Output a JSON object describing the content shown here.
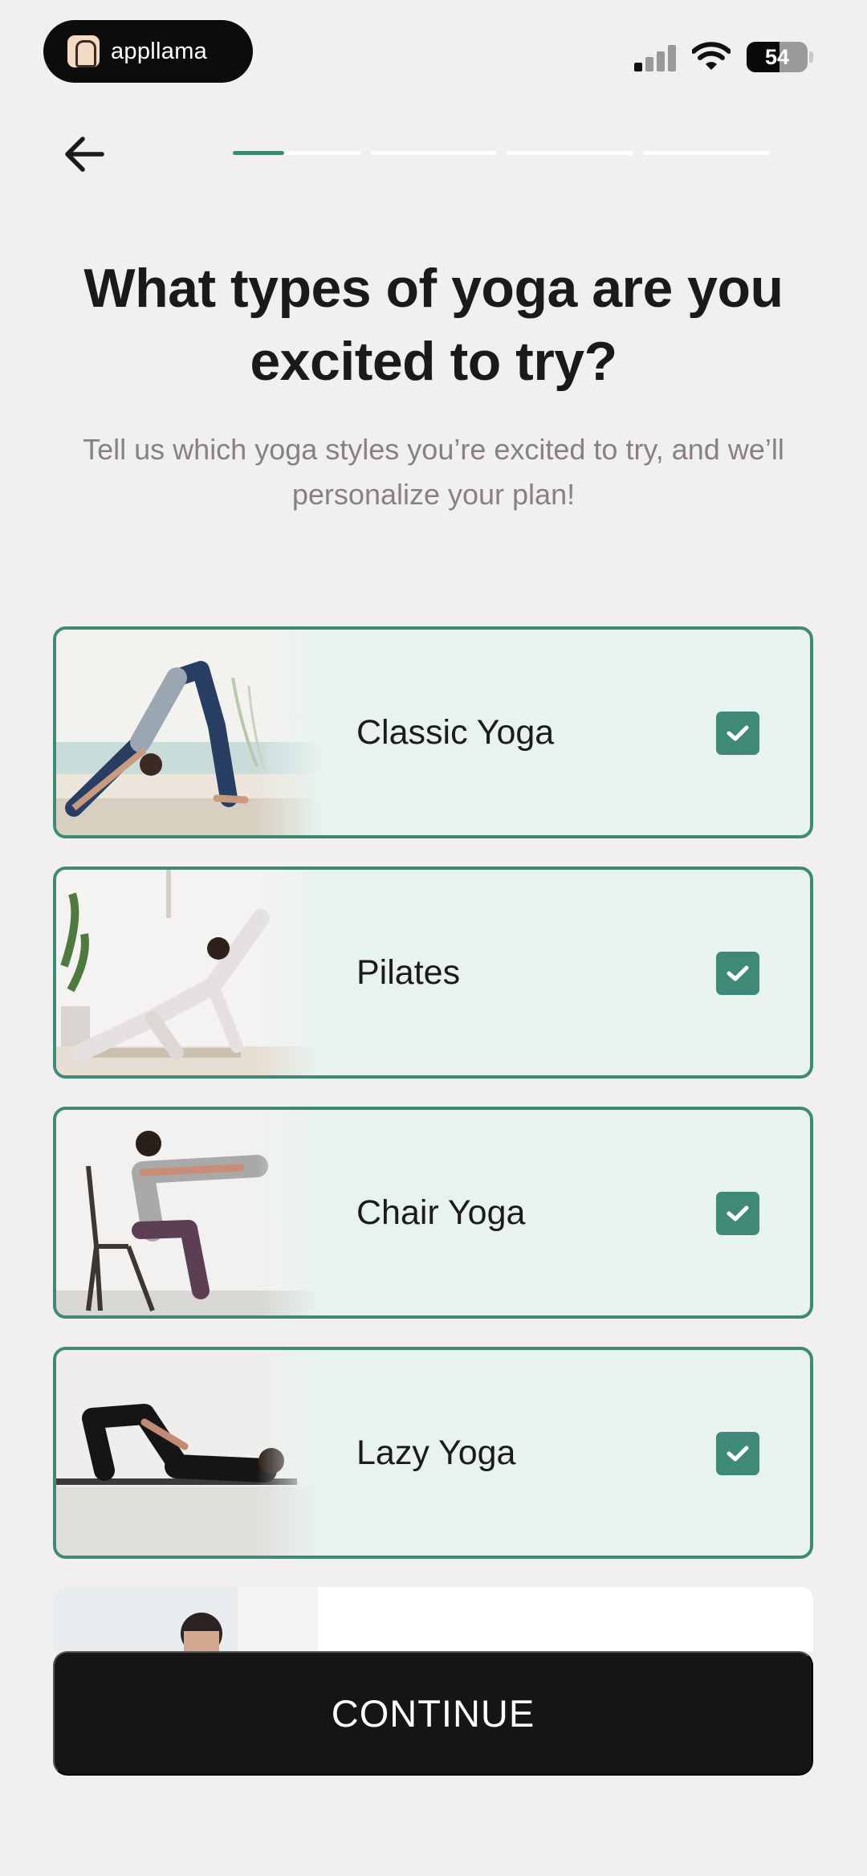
{
  "status_bar": {
    "app_pill_label": "appllama",
    "battery_level": "54",
    "signal_icon": "signal-bars-icon",
    "wifi_icon": "wifi-icon"
  },
  "nav": {
    "back_icon": "arrow-left-icon",
    "progress": {
      "steps": 4,
      "current_step": 1,
      "current_step_fill": 0.4
    }
  },
  "page": {
    "title": "What types of yoga are you excited to try?",
    "subtitle": "Tell us which yoga styles you’re excited to try, and we’ll personalize your plan!"
  },
  "options": [
    {
      "label": "Classic Yoga",
      "selected": true,
      "image": "downward-dog-pose"
    },
    {
      "label": "Pilates",
      "selected": true,
      "image": "side-angle-pose"
    },
    {
      "label": "Chair Yoga",
      "selected": true,
      "image": "chair-squat-pose"
    },
    {
      "label": "Lazy Yoga",
      "selected": true,
      "image": "supine-knee-hug-pose"
    }
  ],
  "continue_label": "CONTINUE",
  "colors": {
    "accent": "#3f8a76",
    "card_background": "#e8f3f0",
    "page_background": "#f1eff0",
    "button_background": "#161516"
  }
}
